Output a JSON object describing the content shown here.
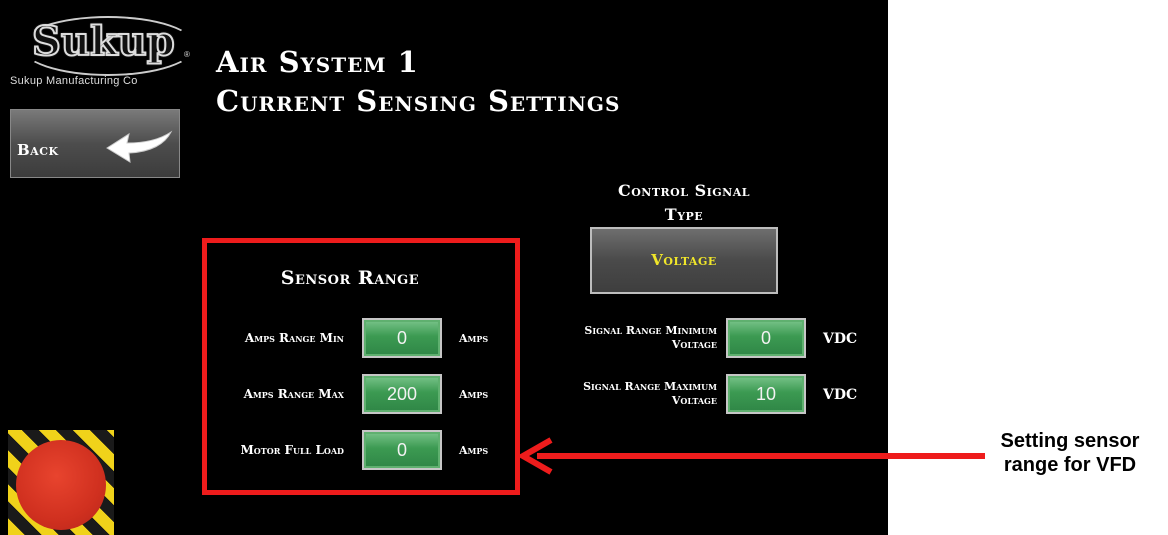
{
  "logo": {
    "brand": "Sukup",
    "registered": "®",
    "subtitle": "Sukup Manufacturing Co"
  },
  "header": {
    "back_label": "Back",
    "title_line1": "Air System 1",
    "title_line2": "Current Sensing Settings"
  },
  "sensor_range": {
    "heading": "Sensor Range",
    "fields": [
      {
        "label": "Amps Range Min",
        "value": "0",
        "unit": "Amps"
      },
      {
        "label": "Amps Range Max",
        "value": "200",
        "unit": "Amps"
      },
      {
        "label": "Motor Full Load",
        "value": "0",
        "unit": "Amps"
      }
    ]
  },
  "control_signal": {
    "heading_line1": "Control Signal",
    "heading_line2": "Type",
    "type_value": "Voltage",
    "fields": [
      {
        "label_line1": "Signal Range Minimum",
        "label_line2": "Voltage",
        "value": "0",
        "unit": "VDC"
      },
      {
        "label_line1": "Signal Range Maximum",
        "label_line2": "Voltage",
        "value": "10",
        "unit": "VDC"
      }
    ]
  },
  "annotation": {
    "line1": "Setting sensor",
    "line2": "range for VFD"
  },
  "colors": {
    "background": "#000000",
    "field_green": "#3c9a52",
    "voltage_text": "#f0e62a",
    "highlight_red": "#ee1c1c",
    "estop_red": "#d0301f"
  }
}
